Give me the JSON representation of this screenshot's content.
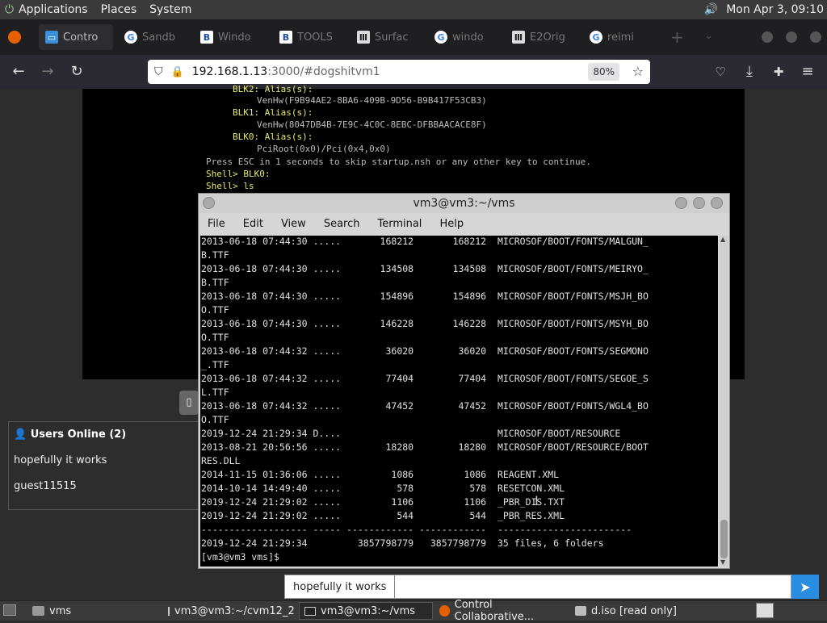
{
  "top_panel": {
    "menus": [
      "Applications",
      "Places",
      "System"
    ],
    "clock": "Mon Apr  3, 09:10"
  },
  "tabs": [
    {
      "label": "Contro",
      "icon": "monitor-icon"
    },
    {
      "label": "Sandb",
      "icon": "google-icon"
    },
    {
      "label": "Windo",
      "icon": "bat-icon"
    },
    {
      "label": "TOOLS",
      "icon": "bat-icon"
    },
    {
      "label": "Surfac",
      "icon": "museum-icon"
    },
    {
      "label": "windo",
      "icon": "google-icon"
    },
    {
      "label": "E2Orig",
      "icon": "museum-icon"
    },
    {
      "label": "reimi",
      "icon": "google-icon"
    }
  ],
  "navbar": {
    "url_host": "192.168.1.13",
    "url_rest": ":3000/#dogshitvm1",
    "zoom": "80%"
  },
  "vm_screen_lines": [
    {
      "text": "BLK2: Alias(s):",
      "cls": "yel"
    },
    {
      "text": "VenHw(F9B94AE2-8BA6-409B-9D56-B9B417F53CB3)",
      "cls": ""
    },
    {
      "text": "BLK1: Alias(s):",
      "cls": "yel"
    },
    {
      "text": "VenHw(8047DB4B-7E9C-4C0C-8EBC-DFBBAACACE8F)",
      "cls": ""
    },
    {
      "text": "BLK0: Alias(s):",
      "cls": "yel"
    },
    {
      "text": "PciRoot(0x0)/Pci(0x4,0x0)",
      "cls": ""
    },
    {
      "text": "Press ESC in 1 seconds to skip startup.nsh or any other key to continue.",
      "cls": ""
    },
    {
      "text": "Shell> BLK0:",
      "cls": "yel"
    },
    {
      "text": "Shell> ls",
      "cls": "yel"
    }
  ],
  "users_panel": {
    "title": "Users Online (2)",
    "users": [
      "hopefully it works",
      "guest11515"
    ]
  },
  "chat": {
    "value": "hopefully it works"
  },
  "terminal": {
    "title": "vm3@vm3:~/vms",
    "menu": [
      "File",
      "Edit",
      "View",
      "Search",
      "Terminal",
      "Help"
    ],
    "lines": [
      "2013-06-18 07:44:30 .....       168212       168212  MICROSOF/BOOT/FONTS/MALGUN_",
      "B.TTF",
      "2013-06-18 07:44:30 .....       134508       134508  MICROSOF/BOOT/FONTS/MEIRYO_",
      "B.TTF",
      "2013-06-18 07:44:30 .....       154896       154896  MICROSOF/BOOT/FONTS/MSJH_BO",
      "O.TTF",
      "2013-06-18 07:44:30 .....       146228       146228  MICROSOF/BOOT/FONTS/MSYH_BO",
      "O.TTF",
      "2013-06-18 07:44:32 .....        36020        36020  MICROSOF/BOOT/FONTS/SEGMONO",
      "_.TTF",
      "2013-06-18 07:44:32 .....        77404        77404  MICROSOF/BOOT/FONTS/SEGOE_S",
      "L.TTF",
      "2013-06-18 07:44:32 .....        47452        47452  MICROSOF/BOOT/FONTS/WGL4_BO",
      "O.TTF",
      "2019-12-24 21:29:34 D....                            MICROSOF/BOOT/RESOURCE",
      "2013-08-21 20:56:56 .....        18280        18280  MICROSOF/BOOT/RESOURCE/BOOT",
      "RES.DLL",
      "2014-11-15 01:36:06 .....         1086         1086  REAGENT.XML",
      "2014-10-14 14:49:40 .....          578          578  RESETCON.XML",
      "2019-12-24 21:29:02 .....         1106         1106  _PBR_DIS.TXT",
      "2019-12-24 21:29:02 .....          544          544  _PBR_RES.XML",
      "------------------- ----- ------------ ------------  ------------------------",
      "2019-12-24 21:29:34         3857798779   3857798779  35 files, 6 folders",
      "[vm3@vm3 vms]$ "
    ]
  },
  "taskbar": [
    {
      "label": "vms",
      "icon": "folder-icon",
      "pressed": false
    },
    {
      "label": "vm3@vm3:~/cvm12_2",
      "icon": "terminal-icon",
      "pressed": false
    },
    {
      "label": "vm3@vm3:~/vms",
      "icon": "terminal-icon",
      "pressed": true
    },
    {
      "label": "Control Collaborative...",
      "icon": "firefox-icon",
      "pressed": false
    },
    {
      "label": "d.iso [read only]",
      "icon": "archive-icon",
      "pressed": false
    }
  ]
}
